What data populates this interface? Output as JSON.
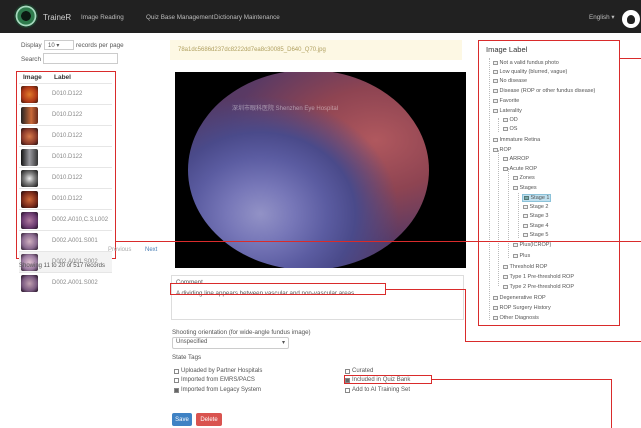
{
  "nav": {
    "brand": "TraineR",
    "links": [
      "Image Reading",
      "Quiz Base Management",
      "Dictionary Maintenance"
    ],
    "language": "English"
  },
  "list": {
    "display_label": "Display",
    "display_value": "10",
    "records_label": "records per page",
    "search_label": "Search",
    "search_value": "",
    "col_image": "Image",
    "col_label": "Label",
    "rows": [
      "D010.D122",
      "D010.D122",
      "D010.D122",
      "D010.D122",
      "D010.D122",
      "D010.D122",
      "D002.A010,C.3,L002",
      "D002.A001.S001",
      "D002.A001.S002",
      "D002.A001.S002"
    ],
    "showing": "Showing 11 to 20 of 517 records",
    "prev": "Previous",
    "next": "Next"
  },
  "viewer": {
    "filename": "78a1dc5686d237dc8222dd7ea8c30085_D640_Q70.jpg",
    "watermark": "深圳市眼科医院 Shenzhen Eye Hospital"
  },
  "comment": {
    "label": "Comment",
    "value": "A dividing line appears between vascular and non-vascular areas"
  },
  "orientation": {
    "label": "Shooting orientation (for wide-angle fundus image)",
    "value": "Unspecified"
  },
  "state_tags": {
    "label": "State Tags",
    "items": [
      {
        "text": "Uploaded by Partner Hospitals",
        "checked": false
      },
      {
        "text": "Imported from EMRS/PACS",
        "checked": false
      },
      {
        "text": "Imported from Legacy System",
        "checked": true
      },
      {
        "text": "Curated",
        "checked": false
      },
      {
        "text": "Included in Quiz Bank",
        "checked": true
      },
      {
        "text": "Add to AI Training Set",
        "checked": false
      }
    ]
  },
  "buttons": {
    "save": "Save",
    "delete": "Delete"
  },
  "image_label": {
    "title": "Image Label",
    "nodes": [
      {
        "text": "Not a valid fundus photo",
        "checked": false
      },
      {
        "text": "Low quality (blurred, vague)",
        "checked": false
      },
      {
        "text": "No disease",
        "checked": false
      },
      {
        "text": "Disease (ROP or other fundus disease)",
        "checked": false
      },
      {
        "text": "Favorite",
        "checked": false
      },
      {
        "text": "Laterality",
        "checked": false
      },
      {
        "text": "OD",
        "checked": false
      },
      {
        "text": "OS",
        "checked": false
      },
      {
        "text": "Immature Retina",
        "checked": false
      },
      {
        "text": "ROP",
        "checked": false
      },
      {
        "text": "ARROP",
        "checked": false
      },
      {
        "text": "Acute ROP",
        "checked": false
      },
      {
        "text": "Zones",
        "checked": false
      },
      {
        "text": "Stages",
        "checked": false
      },
      {
        "text": "Stage 1",
        "checked": true
      },
      {
        "text": "Stage 2",
        "checked": false
      },
      {
        "text": "Stage 3",
        "checked": false
      },
      {
        "text": "Stage 4",
        "checked": false
      },
      {
        "text": "Stage 5",
        "checked": false
      },
      {
        "text": "Plus(ICROP)",
        "checked": false
      },
      {
        "text": "Plus",
        "checked": false
      },
      {
        "text": "Threshold ROP",
        "checked": false
      },
      {
        "text": "Type 1 Pre-threshold ROP",
        "checked": false
      },
      {
        "text": "Type 2 Pre-threshold ROP",
        "checked": false
      },
      {
        "text": "Degenerative ROP",
        "checked": false
      },
      {
        "text": "ROP Surgery History",
        "checked": false
      },
      {
        "text": "Other Diagnosis",
        "checked": false
      }
    ]
  },
  "colors": {
    "annotation_red": "#d92b2b",
    "save_blue": "#3f82c4",
    "delete_red": "#d9534f",
    "selected_node": "#bfe0ef"
  }
}
